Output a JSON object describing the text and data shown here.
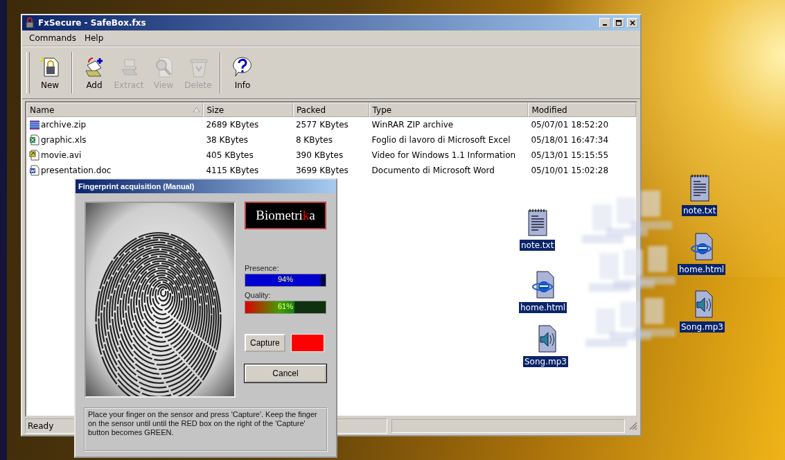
{
  "window": {
    "title": "FxSecure - SafeBox.fxs"
  },
  "menu": [
    "Commands",
    "Help"
  ],
  "toolbar": [
    {
      "kind": "new",
      "label": "New",
      "disabled": false
    },
    {
      "kind": "add",
      "label": "Add",
      "disabled": false
    },
    {
      "kind": "extract",
      "label": "Extract",
      "disabled": true
    },
    {
      "kind": "view",
      "label": "View",
      "disabled": true
    },
    {
      "kind": "delete",
      "label": "Delete",
      "disabled": true
    },
    {
      "kind": "info",
      "label": "Info",
      "disabled": false
    }
  ],
  "table": {
    "columns": [
      "Name",
      "Size",
      "Packed",
      "Type",
      "Modified"
    ],
    "rows": [
      {
        "kind": "zip",
        "cells": [
          "archive.zip",
          "2689 KBytes",
          "2577 KBytes",
          "WinRAR ZIP archive",
          "05/07/01 18:52:20"
        ]
      },
      {
        "kind": "xls",
        "cells": [
          "graphic.xls",
          "38 KBytes",
          "8 KBytes",
          "Foglio di lavoro di Microsoft Excel",
          "05/18/01 16:47:34"
        ]
      },
      {
        "kind": "avi",
        "cells": [
          "movie.avi",
          "405 KBytes",
          "390 KBytes",
          "Video for Windows 1.1 Information",
          "05/13/01 15:15:55"
        ]
      },
      {
        "kind": "doc",
        "cells": [
          "presentation.doc",
          "4115 KBytes",
          "3699 KBytes",
          "Documento di Microsoft Word",
          "05/10/01 15:02:28"
        ]
      }
    ]
  },
  "status_bar": {
    "text": "Ready"
  },
  "dialog": {
    "title": "Fingerprint acquisition (Manual)",
    "logo": [
      {
        "text": "Biometri",
        "color": "#ffffff"
      },
      {
        "text": "k",
        "color": "#ff0000"
      },
      {
        "text": "a",
        "color": "#ffffff"
      }
    ],
    "meters": [
      {
        "kind": "presence",
        "label": "Presence:",
        "level": 0.94,
        "reading": "94%"
      },
      {
        "kind": "quality",
        "label": "Quality:",
        "level": 0.61,
        "reading": "61%"
      }
    ],
    "capture_button": "Capture",
    "capture_indicator": {
      "color": "#ff0000"
    },
    "cancel_button": "Cancel",
    "instructions": "Place your finger on the sensor and press 'Capture'. Keep the finger on the sensor until until the RED box on the right of the 'Capture' button becomes GREEN."
  },
  "desktop_icons": [
    {
      "kind": "text",
      "label": "note.txt",
      "selected": true
    },
    {
      "kind": "html",
      "label": "home.html",
      "selected": true
    },
    {
      "kind": "audio",
      "label": "Song.mp3",
      "selected": true
    },
    {
      "kind": "text",
      "label": "note.txt",
      "selected": true
    },
    {
      "kind": "html",
      "label": "home.html",
      "selected": true
    },
    {
      "kind": "audio",
      "label": "Song.mp3",
      "selected": true
    }
  ]
}
